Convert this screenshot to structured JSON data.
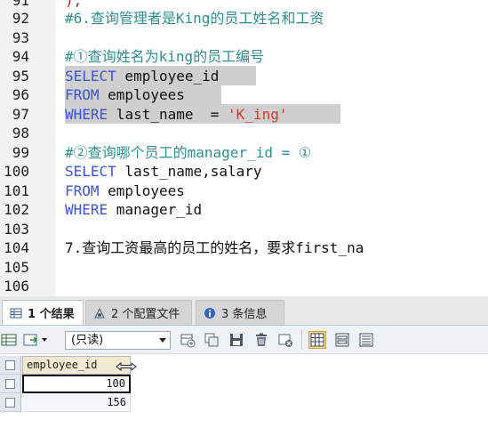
{
  "editor": {
    "line_numbers": [
      "91",
      "92",
      "93",
      "94",
      "95",
      "96",
      "97",
      "98",
      "99",
      "100",
      "101",
      "102",
      "103",
      "104",
      "105",
      "106"
    ],
    "line91": ");",
    "line92": "#6.查询管理者是King的员工姓名和工资",
    "line94": "#①查询姓名为king的员工编号",
    "line95_kw": "SELECT",
    "line95_rest": " employee_id",
    "line96_kw": "FROM",
    "line96_rest": " employees",
    "line97_kw": "WHERE",
    "line97_rest": " last_name  = ",
    "line97_str": "'K_ing'",
    "line99": "#②查询哪个员工的manager_id = ①",
    "line100_kw": "SELECT",
    "line100_rest": " last_name,salary",
    "line101_kw": "FROM",
    "line101_rest": " employees",
    "line102_kw": "WHERE",
    "line102_rest": " manager_id",
    "line104": "7.查询工资最高的员工的姓名，要求first_na"
  },
  "tabs": [
    {
      "label": "1 个结果",
      "icon": "result-grid-icon",
      "active": true
    },
    {
      "label": "2 个配置文件",
      "icon": "profile-icon",
      "active": false
    },
    {
      "label": "3 条信息",
      "icon": "info-icon",
      "active": false
    }
  ],
  "toolbar": {
    "mode_select_value": "(只读)"
  },
  "grid": {
    "column": "employee_id",
    "rows": [
      "100",
      "156"
    ]
  },
  "colors": {
    "keyword": "#3b54d8",
    "comment": "#2f8f8f",
    "string": "#d6382a",
    "selection": "#cfcfcf"
  }
}
